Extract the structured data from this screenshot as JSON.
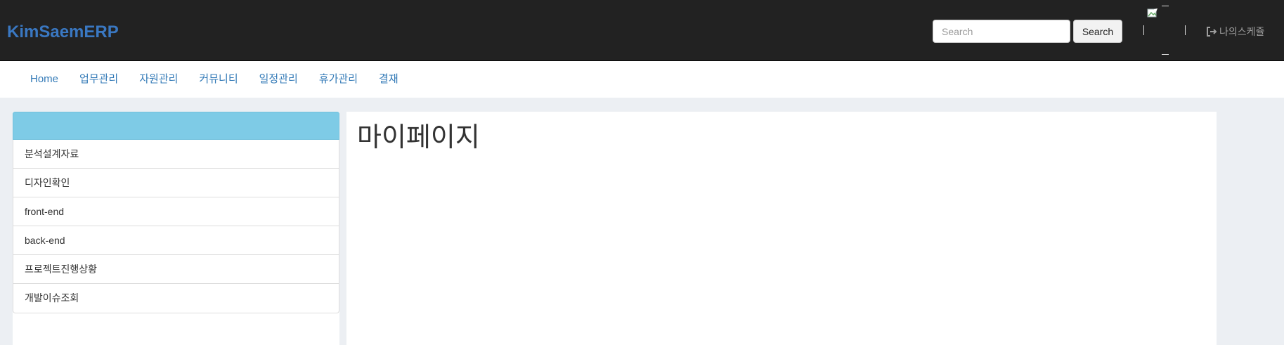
{
  "brand": {
    "name": "KimSaemERP"
  },
  "search": {
    "placeholder": "Search",
    "button_label": "Search"
  },
  "header": {
    "logout_label": "나의스케쥴"
  },
  "nav": {
    "items": [
      {
        "label": "Home"
      },
      {
        "label": "업무관리"
      },
      {
        "label": "자원관리"
      },
      {
        "label": "커뮤니티"
      },
      {
        "label": "일정관리"
      },
      {
        "label": "휴가관리"
      },
      {
        "label": "결재"
      }
    ]
  },
  "sidebar": {
    "items": [
      {
        "label": "분석설계자료"
      },
      {
        "label": "디자인확인"
      },
      {
        "label": "front-end"
      },
      {
        "label": "back-end"
      },
      {
        "label": "프로젝트진행상황"
      },
      {
        "label": "개발이슈조회"
      }
    ]
  },
  "main": {
    "title": "마이페이지"
  },
  "colors": {
    "topbar": "#222222",
    "brand": "#3a78c2",
    "nav_link": "#337ab7",
    "sidebar_header": "#7ecbe6",
    "page_background": "#eceff3"
  },
  "icons": {
    "logout": "logout-icon",
    "avatar": "broken-image-icon"
  }
}
